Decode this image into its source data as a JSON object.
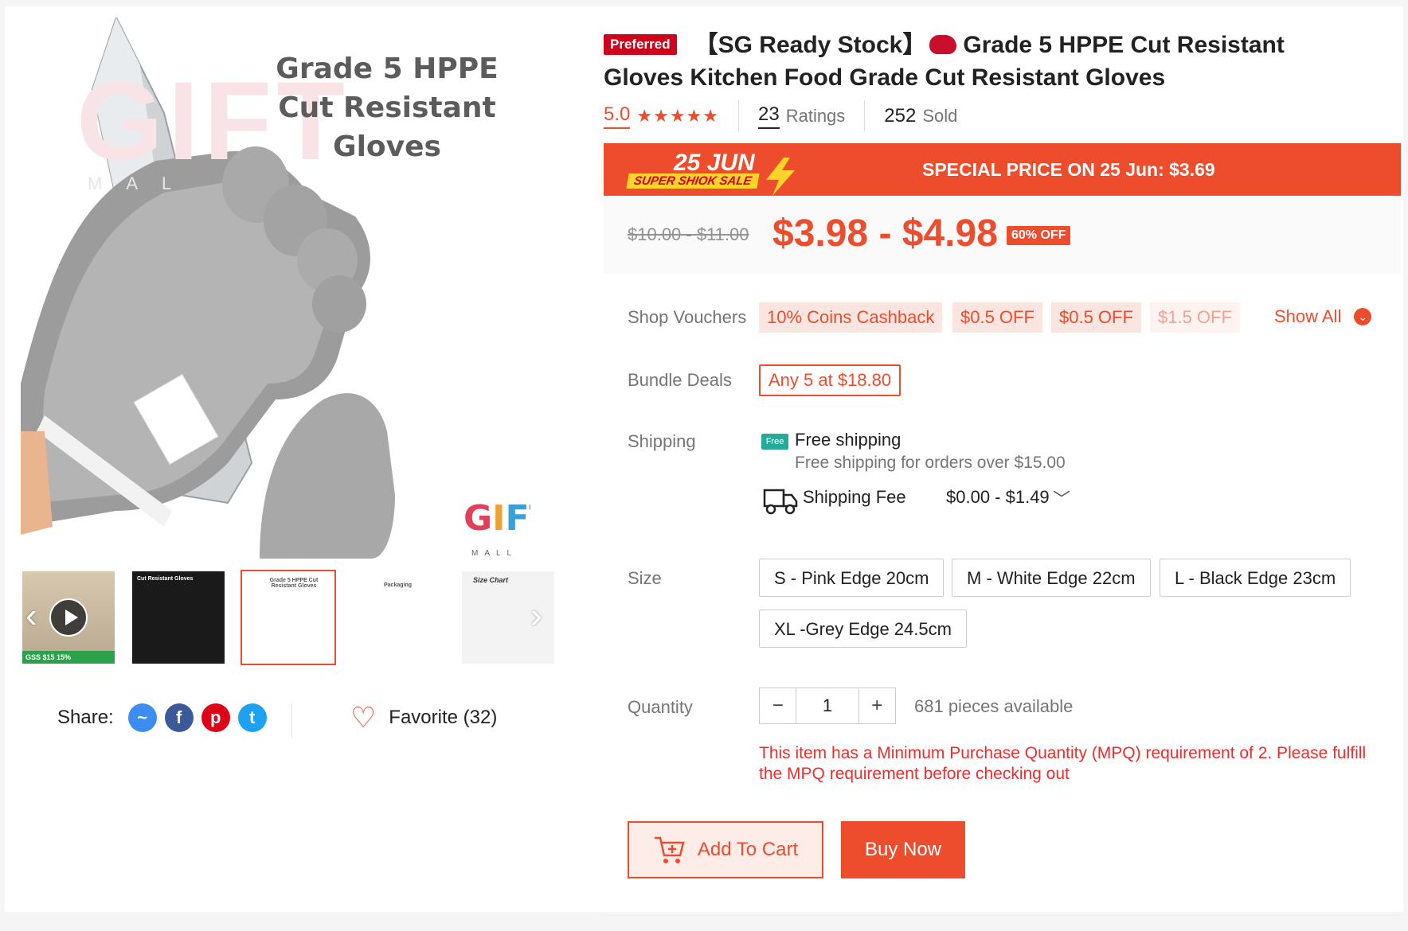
{
  "product": {
    "preferred_badge": "Preferred",
    "title_part1": "【SG Ready Stock】",
    "title_part2": "Grade 5 HPPE Cut Resistant Gloves Kitchen Food Grade Cut Resistant Gloves",
    "rating": "5.0",
    "stars": "★★★★★",
    "ratings_count": "23",
    "ratings_label": "Ratings",
    "sold_count": "252",
    "sold_label": "Sold"
  },
  "image": {
    "watermark": "GIFT",
    "watermark_sub": "MAL",
    "title_lines": [
      "Grade 5 HPPE",
      "Cut Resistant",
      "Gloves"
    ],
    "logo": [
      "G",
      "I",
      "F",
      "T"
    ],
    "logo_sub": "MALL SG"
  },
  "thumbnails": [
    {
      "caption": "",
      "strip": "GSS  $15  15%"
    },
    {
      "caption": "Cut Resistant Gloves"
    },
    {
      "caption": "Grade 5 HPPE Cut Resistant Gloves"
    },
    {
      "caption": "Packaging"
    },
    {
      "caption": "Size Chart"
    }
  ],
  "share": {
    "label": "Share:",
    "icons": [
      "messenger-icon",
      "facebook-icon",
      "pinterest-icon",
      "twitter-icon"
    ],
    "favorite_label": "Favorite (32)"
  },
  "flash_sale": {
    "date": "25 JUN",
    "tag": "SUPER SHIOK SALE",
    "text": "SPECIAL PRICE ON 25 Jun: $3.69"
  },
  "price": {
    "original": "$10.00 - $11.00",
    "current": "$3.98 - $4.98",
    "discount": "60% OFF"
  },
  "vouchers": {
    "label": "Shop Vouchers",
    "items": [
      "10% Coins Cashback",
      "$0.5 OFF",
      "$0.5 OFF",
      "$1.5 OFF"
    ],
    "show_all": "Show All"
  },
  "bundle": {
    "label": "Bundle Deals",
    "value": "Any 5 at $18.80"
  },
  "shipping": {
    "label": "Shipping",
    "free_badge": "Free",
    "free_title": "Free shipping",
    "free_sub": "Free shipping for orders over $15.00",
    "fee_label": "Shipping Fee",
    "fee_value": "$0.00 - $1.49"
  },
  "size": {
    "label": "Size",
    "options": [
      "S - Pink Edge 20cm",
      "M - White Edge 22cm",
      "L - Black Edge 23cm",
      "XL -Grey Edge 24.5cm"
    ]
  },
  "quantity": {
    "label": "Quantity",
    "minus": "−",
    "value": "1",
    "plus": "+",
    "available": "681 pieces available",
    "mpq_notice": "This item has a Minimum Purchase Quantity (MPQ) requirement of 2. Please fulfill the MPQ requirement before checking out"
  },
  "actions": {
    "add_to_cart": "Add To Cart",
    "buy_now": "Buy Now"
  },
  "colors": {
    "accent": "#ee4d2d",
    "preferred": "#d0011b",
    "free_ship": "#26aa99"
  }
}
